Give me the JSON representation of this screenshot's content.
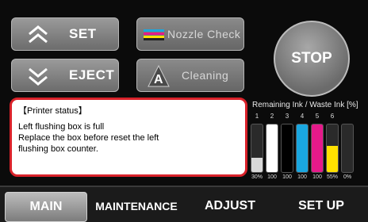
{
  "controls": {
    "set_label": "SET",
    "eject_label": "EJECT",
    "nozzle_check_label": "Nozzle Check",
    "cleaning_label": "Cleaning",
    "stop_label": "STOP"
  },
  "status": {
    "title": "【Printer status】",
    "lines": [
      "Left flushing box is full",
      "Replace the box before reset the left",
      "flushing box counter."
    ]
  },
  "ink": {
    "header": "Remaining Ink / Waste Ink [%]",
    "slots": [
      {
        "num": "1",
        "pct": "30%",
        "level": 30,
        "color": "#d8d8d8"
      },
      {
        "num": "2",
        "pct": "100",
        "level": 100,
        "color": "#ffffff"
      },
      {
        "num": "3",
        "pct": "100",
        "level": 100,
        "color": "#000000"
      },
      {
        "num": "4",
        "pct": "100",
        "level": 100,
        "color": "#1aa7e0"
      },
      {
        "num": "5",
        "pct": "100",
        "level": 100,
        "color": "#e51a8a"
      },
      {
        "num": "6",
        "pct": "55%",
        "level": 55,
        "color": "#ffe100"
      },
      {
        "num": "",
        "pct": "0%",
        "level": 0,
        "color": "#888888"
      }
    ]
  },
  "tabs": {
    "main": "MAIN",
    "maintenance": "MAINTENANCE",
    "adjust": "ADJUST",
    "setup": "SET UP"
  }
}
